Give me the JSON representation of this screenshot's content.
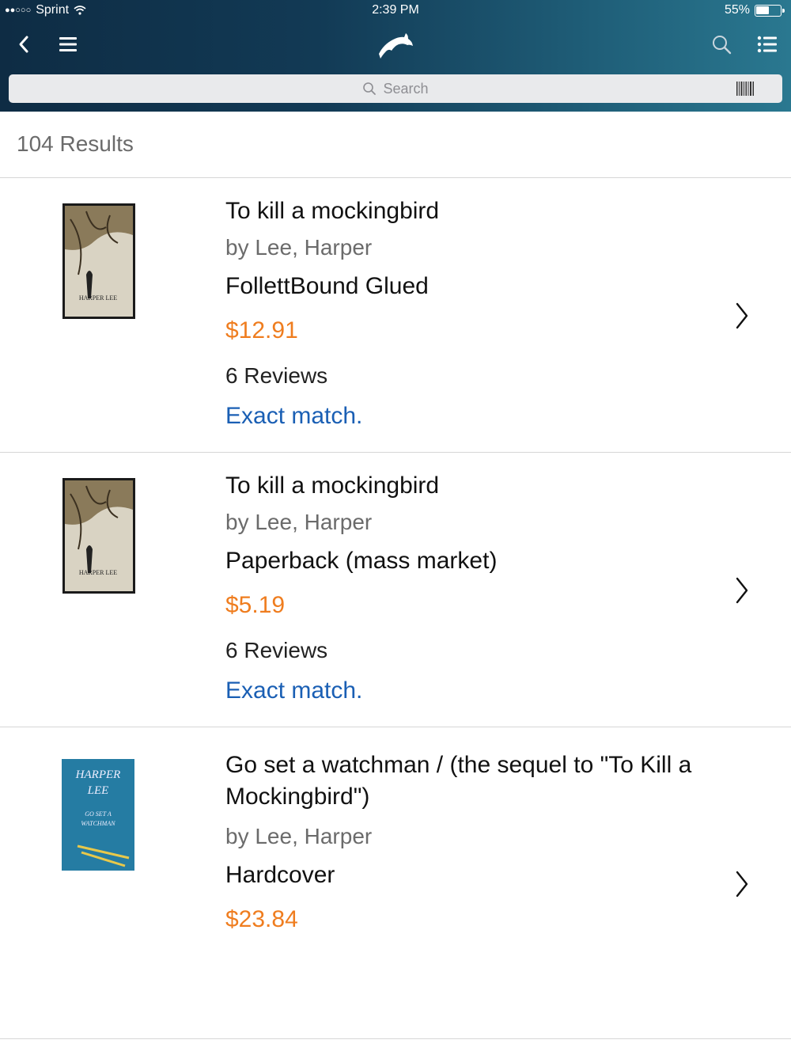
{
  "status_bar": {
    "carrier": "Sprint",
    "time": "2:39 PM",
    "battery_percent": "55%",
    "battery_level": 0.55
  },
  "nav": {
    "back_icon": "chevron-left-icon",
    "menu_icon": "hamburger-icon",
    "logo_icon": "dolphin-logo",
    "search_icon": "search-icon",
    "list_icon": "list-icon"
  },
  "search": {
    "placeholder": "Search",
    "barcode_icon": "barcode-icon"
  },
  "results": {
    "count_label": "104 Results"
  },
  "items": [
    {
      "title": "To kill a mockingbird",
      "author": "by Lee, Harper",
      "format": "FollettBound Glued",
      "price": "$12.91",
      "reviews": "6 Reviews",
      "match": "Exact match.",
      "cover_text": "HARPER LEE"
    },
    {
      "title": "To kill a mockingbird",
      "author": "by Lee, Harper",
      "format": "Paperback (mass market)",
      "price": "$5.19",
      "reviews": "6 Reviews",
      "match": "Exact match.",
      "cover_text": "HARPER LEE"
    },
    {
      "title": "Go set a watchman / (the sequel to \"To Kill a Mockingbird\")",
      "author": "by Lee, Harper",
      "format": "Hardcover",
      "price": "$23.84",
      "cover_text": "HARPER LEE GO SET A WATCHMAN"
    }
  ],
  "colors": {
    "header_dark": "#0e2c44",
    "header_light": "#2a7890",
    "price": "#ef7d1f",
    "link": "#1a5fb4"
  }
}
